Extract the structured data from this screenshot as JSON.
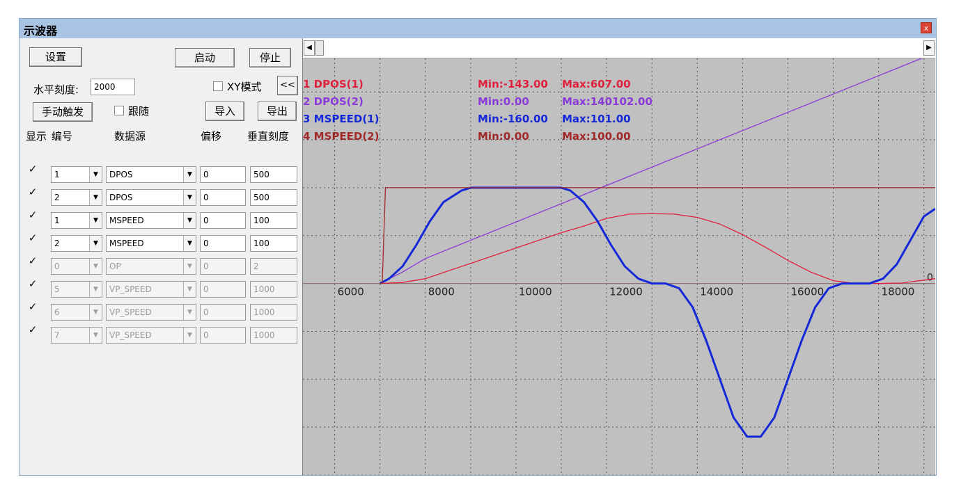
{
  "window": {
    "title": "示波器",
    "close_label": "x"
  },
  "toolbar": {
    "settings": "设置",
    "start": "启动",
    "stop": "停止",
    "horizontal_scale_label": "水平刻度:",
    "horizontal_scale_value": "2000",
    "xy_mode_label": "XY模式",
    "collapse": "<<",
    "manual_trigger": "手动触发",
    "follow_label": "跟随",
    "import": "导入",
    "export": "导出"
  },
  "table": {
    "headers": {
      "show": "显示",
      "number": "编号",
      "source": "数据源",
      "offset": "偏移",
      "vscale": "垂直刻度"
    },
    "rows": [
      {
        "checked": "✓",
        "number": "1",
        "source": "DPOS",
        "offset": "0",
        "vscale": "500",
        "enabled": true
      },
      {
        "checked": "✓",
        "number": "2",
        "source": "DPOS",
        "offset": "0",
        "vscale": "500",
        "enabled": true
      },
      {
        "checked": "✓",
        "number": "1",
        "source": "MSPEED",
        "offset": "0",
        "vscale": "100",
        "enabled": true
      },
      {
        "checked": "✓",
        "number": "2",
        "source": "MSPEED",
        "offset": "0",
        "vscale": "100",
        "enabled": true
      },
      {
        "checked": "✓",
        "number": "0",
        "source": "OP",
        "offset": "0",
        "vscale": "2",
        "enabled": false
      },
      {
        "checked": "✓",
        "number": "5",
        "source": "VP_SPEED",
        "offset": "0",
        "vscale": "1000",
        "enabled": false
      },
      {
        "checked": "✓",
        "number": "6",
        "source": "VP_SPEED",
        "offset": "0",
        "vscale": "1000",
        "enabled": false
      },
      {
        "checked": "✓",
        "number": "7",
        "source": "VP_SPEED",
        "offset": "0",
        "vscale": "1000",
        "enabled": false
      }
    ]
  },
  "scroll": {
    "left_arrow": "◀",
    "right_arrow": "▶"
  },
  "scope": {
    "background": "#c0c0c0",
    "legend": [
      {
        "name": "1 DPOS(1)",
        "min": "Min:-143.00",
        "max": "Max:607.00",
        "color": "#e0203c"
      },
      {
        "name": "2 DPOS(2)",
        "min": "Min:0.00",
        "max": "Max:140102.00",
        "color": "#8a3ad8"
      },
      {
        "name": "3 MSPEED(1)",
        "min": "Min:-160.00",
        "max": "Max:101.00",
        "color": "#1428d8"
      },
      {
        "name": "4 MSPEED(2)",
        "min": "Min:0.00",
        "max": "Max:100.00",
        "color": "#a02828"
      }
    ],
    "x_tick_labels": [
      "6000",
      "8000",
      "10000",
      "12000",
      "14000",
      "16000",
      "18000"
    ],
    "zero_label": "0"
  },
  "chart_data": {
    "type": "line",
    "x_ticks": [
      6000,
      8000,
      10000,
      12000,
      14000,
      16000,
      18000
    ],
    "xlim": [
      5300,
      19250
    ],
    "ylim_divisions": [
      -2,
      2.35
    ],
    "grid": true,
    "series": [
      {
        "name": "1 DPOS(1)",
        "vscale": 500,
        "color": "#e0203c",
        "x": [
          7000,
          7500,
          8000,
          9000,
          10000,
          11000,
          11500,
          12000,
          12500,
          13000,
          13500,
          14000,
          14500,
          15000,
          15500,
          16000,
          16500,
          17000,
          17500,
          18000,
          18500,
          19250
        ],
        "y": [
          0,
          5,
          25,
          105,
          185,
          265,
          300,
          340,
          362,
          365,
          362,
          345,
          310,
          255,
          190,
          120,
          60,
          15,
          0,
          0,
          2,
          25
        ]
      },
      {
        "name": "2 DPOS(2)",
        "vscale": 500,
        "color": "#8a3ad8",
        "x": [
          7000,
          7500,
          8000,
          19000
        ],
        "y": [
          0,
          60,
          130,
          1180
        ]
      },
      {
        "name": "3 MSPEED(1)",
        "vscale": 100,
        "color": "#1428d8",
        "x": [
          7000,
          7200,
          7500,
          7800,
          8100,
          8400,
          8800,
          9000,
          10000,
          11000,
          11200,
          11500,
          11800,
          12100,
          12400,
          12700,
          13000,
          13300,
          13600,
          13900,
          14200,
          14500,
          14800,
          15100,
          15400,
          15700,
          16000,
          16300,
          16600,
          16900,
          17200,
          17500,
          17800,
          18100,
          18400,
          18700,
          19000,
          19250
        ],
        "y": [
          0,
          5,
          18,
          40,
          65,
          85,
          97,
          100,
          100,
          100,
          97,
          85,
          65,
          40,
          18,
          5,
          0,
          0,
          -5,
          -25,
          -60,
          -100,
          -140,
          -160,
          -160,
          -140,
          -100,
          -60,
          -25,
          -5,
          0,
          0,
          0,
          5,
          20,
          45,
          70,
          78
        ]
      },
      {
        "name": "4 MSPEED(2)",
        "vscale": 100,
        "color": "#a02828",
        "x": [
          7000,
          7050,
          7120,
          19250
        ],
        "y": [
          0,
          0,
          100,
          100
        ]
      }
    ]
  }
}
